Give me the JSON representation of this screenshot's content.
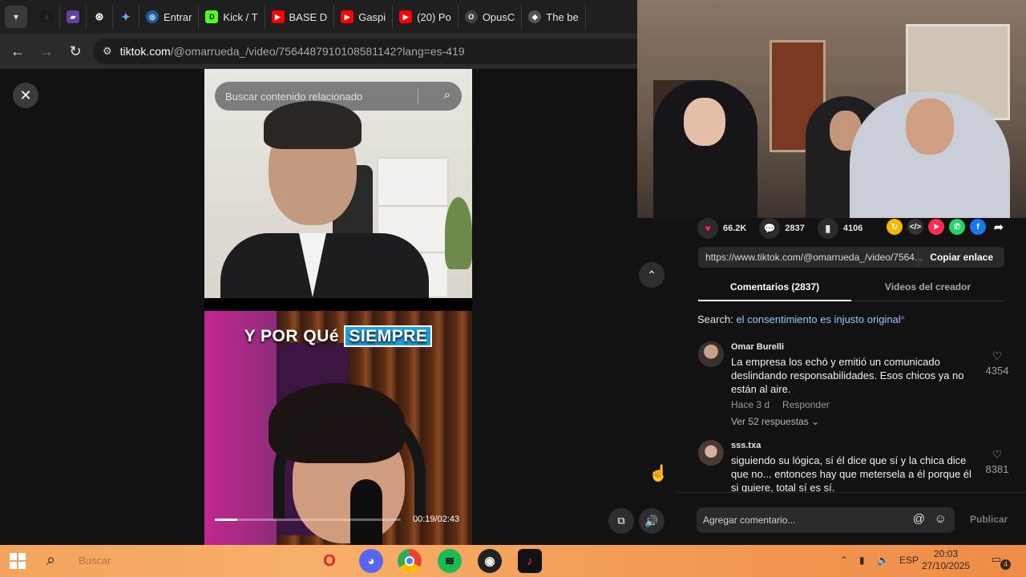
{
  "browser": {
    "tabs": [
      {
        "label": "",
        "icon": "tiktok-icon",
        "color": "#1a1a1a"
      },
      {
        "label": "",
        "icon": "twitch-icon",
        "color": "#6441a5"
      },
      {
        "label": "",
        "icon": "chatgpt-icon",
        "color": "#2a2a2a"
      },
      {
        "label": "",
        "icon": "gemini-icon",
        "color": "#3d6fd8"
      },
      {
        "label": "Entrar",
        "icon": "globe-icon",
        "color": "#1e5aa8"
      },
      {
        "label": "Kick / T",
        "icon": "kick-icon",
        "color": "#53fc18"
      },
      {
        "label": "BASE D",
        "icon": "youtube-icon",
        "color": "#ff0000"
      },
      {
        "label": "Gaspi",
        "icon": "youtube-icon",
        "color": "#ff0000"
      },
      {
        "label": "(20) Po",
        "icon": "youtube-icon",
        "color": "#ff0000"
      },
      {
        "label": "OpusC",
        "icon": "opus-icon",
        "color": "#444"
      },
      {
        "label": "The be",
        "icon": "diamond-icon",
        "color": "#555"
      }
    ],
    "url_site": "tiktok.com",
    "url_path": "/@omarrueda_/video/7564487910108581142?lang=es-419"
  },
  "video": {
    "search_placeholder": "Buscar contenido relacionado",
    "caption_before": "Y POR QUé",
    "caption_highlight": "SIEMPRE",
    "timecode": "00:19/02:43",
    "progress": 0.12
  },
  "stats": {
    "likes": "66.2K",
    "comments": "2837",
    "saves": "4106"
  },
  "share": {
    "link": "https://www.tiktok.com/@omarrueda_/video/7564...",
    "copy_label": "Copiar enlace"
  },
  "tabs": {
    "comments": "Comentarios (2837)",
    "creator": "Videos del creador"
  },
  "search_suggestion": {
    "prefix": "Search:",
    "query": "el consentimiento es injusto original"
  },
  "comments": [
    {
      "user": "Omar Burelli",
      "text": "La empresa los echó y emitió un comunicado deslindando responsabilidades. Esos chicos ya no están al aire.",
      "time": "Hace 3 d",
      "reply_label": "Responder",
      "replies": "Ver 52 respuestas",
      "likes": "4354"
    },
    {
      "user": "sss.txa",
      "text": "siguiendo su lógica, sí él dice que sí y la chica dice que no... entonces hay que metersela a él porque él si quiere, total sí es sí.",
      "likes": "8381"
    }
  ],
  "composer": {
    "placeholder": "Agregar comentario...",
    "post_label": "Publicar"
  },
  "taskbar": {
    "search_text": "Buscar",
    "language": "ESP",
    "time": "20:03",
    "date": "27/10/2025",
    "notifications": "4"
  }
}
